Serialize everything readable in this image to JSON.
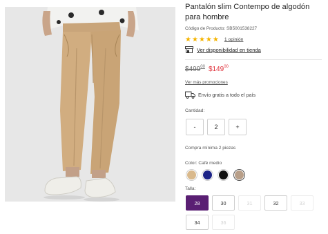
{
  "product": {
    "title": "Pantalón slim Contempo de algodón para hombre",
    "code": "Código de Producto: SB5001538227",
    "rating_stars": 5,
    "opinions": "1 opinión",
    "availability": "Ver disponibilidad en tienda"
  },
  "price": {
    "old_main": "$499",
    "old_cents": "00",
    "new_main": "$149",
    "new_cents": "00",
    "old_color": "#6b6b6b",
    "new_color": "#e0303a"
  },
  "promotions": "Ver más promociones",
  "shipping": "Envío gratis a todo el país",
  "quantity": {
    "label": "Cantidad:",
    "minus": "-",
    "value": "2",
    "plus": "+"
  },
  "minimum": "Compra mínima 2 piezas",
  "color": {
    "label": "Color: Café medio",
    "swatches": [
      {
        "name": "cafe-claro",
        "hex": "#d9b98c"
      },
      {
        "name": "azul-marino",
        "hex": "#1c2387"
      },
      {
        "name": "negro",
        "hex": "#111111"
      },
      {
        "name": "cafe-medio",
        "hex": "#b89f89",
        "selected": true
      }
    ]
  },
  "sizes": {
    "label": "Talla:",
    "accent": "#5a1f73",
    "items": [
      {
        "label": "28",
        "state": "selected"
      },
      {
        "label": "30",
        "state": "available"
      },
      {
        "label": "31",
        "state": "disabled"
      },
      {
        "label": "32",
        "state": "available"
      },
      {
        "label": "33",
        "state": "disabled"
      },
      {
        "label": "34",
        "state": "available"
      },
      {
        "label": "36",
        "state": "disabled"
      }
    ]
  },
  "icons": {
    "star": "star-icon",
    "store": "store-icon",
    "truck": "truck-icon"
  }
}
